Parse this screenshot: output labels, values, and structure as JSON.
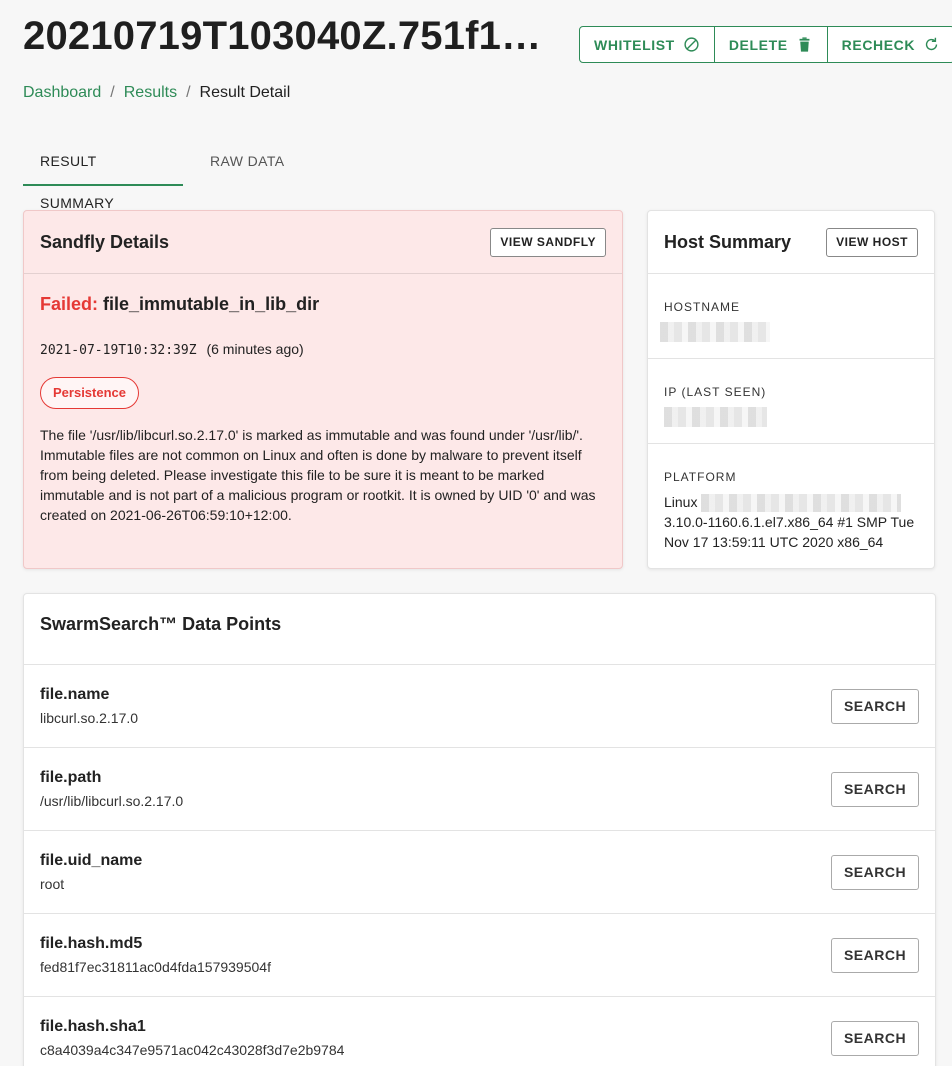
{
  "header": {
    "title": "20210719T103040Z.751f12...",
    "actions": [
      {
        "label": "WHITELIST",
        "icon": "block-icon"
      },
      {
        "label": "DELETE",
        "icon": "trash-icon"
      },
      {
        "label": "RECHECK",
        "icon": "refresh-icon"
      }
    ]
  },
  "breadcrumb": {
    "items": [
      "Dashboard",
      "Results"
    ],
    "separator": "/",
    "current": "Result Detail"
  },
  "tabs": [
    {
      "label": "RESULT SUMMARY",
      "active": true
    },
    {
      "label": "RAW DATA",
      "active": false
    }
  ],
  "sandfly": {
    "title": "Sandfly Details",
    "view_button": "VIEW SANDFLY",
    "status_label": "Failed:",
    "name": "file_immutable_in_lib_dir",
    "timestamp": "2021-07-19T10:32:39Z",
    "relative_time": "(6 minutes ago)",
    "tag": "Persistence",
    "description": "The file '/usr/lib/libcurl.so.2.17.0' is marked as immutable and was found under '/usr/lib/'. Immutable files are not common on Linux and often is done by malware to prevent itself from being deleted. Please investigate this file to be sure it is meant to be marked immutable and is not part of a malicious program or rootkit. It is owned by UID '0' and was created on 2021-06-26T06:59:10+12:00."
  },
  "host": {
    "title": "Host Summary",
    "view_button": "VIEW HOST",
    "hostname_label": "HOSTNAME",
    "ip_label": "IP (LAST SEEN)",
    "platform_label": "PLATFORM",
    "platform_prefix": "Linux",
    "platform_detail": "3.10.0-1160.6.1.el7.x86_64 #1 SMP Tue Nov 17 13:59:11 UTC 2020 x86_64"
  },
  "swarm": {
    "title": "SwarmSearch™ Data Points",
    "search_label": "SEARCH",
    "points": [
      {
        "key": "file.name",
        "value": "libcurl.so.2.17.0"
      },
      {
        "key": "file.path",
        "value": "/usr/lib/libcurl.so.2.17.0"
      },
      {
        "key": "file.uid_name",
        "value": "root"
      },
      {
        "key": "file.hash.md5",
        "value": "fed81f7ec31811ac0d4fda157939504f"
      },
      {
        "key": "file.hash.sha1",
        "value": "c8a4039a4c347e9571ac042c43028f3d7e2b9784"
      }
    ]
  },
  "colors": {
    "accent": "#2e8b57",
    "fail": "#e53935",
    "sandfly_bg": "#fde8e8"
  }
}
